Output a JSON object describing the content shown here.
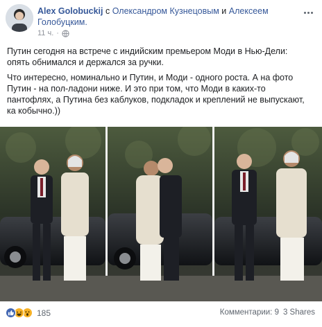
{
  "header": {
    "author_name": "Alex Golobuckij",
    "with_prefix": "с",
    "tagged_1": "Олександром Кузнецовым",
    "and_word": "и",
    "tagged_2": "Алексеем Голобуцким.",
    "time": "11 ч.",
    "separator": "·",
    "privacy_icon": "globe-icon"
  },
  "post": {
    "paragraph_1": "Путин сегодня на встрече с индийским премьером Моди в Нью-Дели: опять обнимался и держался за ручки.",
    "paragraph_2": "Что интересно, номинально и Путин, и Моди - одного роста. А на фото Путин - на пол-ладони ниже. И это при том, что Моди в каких-то пантофлях, а Путина без каблуков, подкладок и креплений не выпускают, ка кобычно.))"
  },
  "footer": {
    "reaction_icons": [
      "like-icon",
      "haha-icon",
      "wow-icon"
    ],
    "reaction_count": "185",
    "comments": "Комментарии: 9",
    "shares": "3 Shares"
  },
  "colors": {
    "link": "#365899",
    "text": "#1c1e21",
    "meta": "#90949c",
    "like": "#4267b2",
    "emoji": "#f7b125"
  }
}
